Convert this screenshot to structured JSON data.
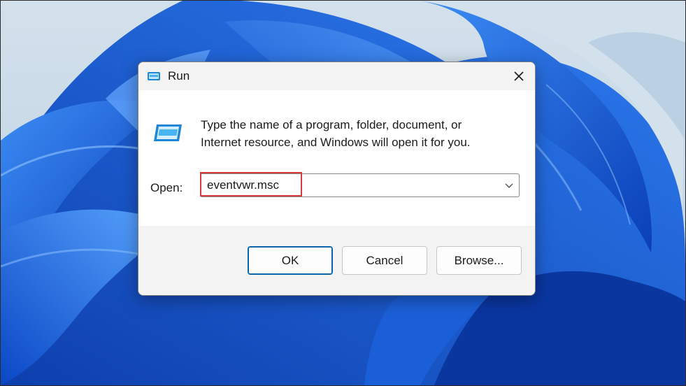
{
  "dialog": {
    "title": "Run",
    "description_line1": "Type the name of a program, folder, document, or",
    "description_line2": "Internet resource, and Windows will open it for you.",
    "open_label": "Open:",
    "open_value": "eventvwr.msc",
    "buttons": {
      "ok": "OK",
      "cancel": "Cancel",
      "browse": "Browse..."
    }
  },
  "icons": {
    "title": "run-icon",
    "body": "run-icon",
    "close": "close-icon",
    "dropdown": "chevron-down-icon"
  },
  "colors": {
    "accent": "#0a64ad",
    "highlight": "#d93a3a",
    "wallpaper_blue": "#1f5fe0"
  }
}
